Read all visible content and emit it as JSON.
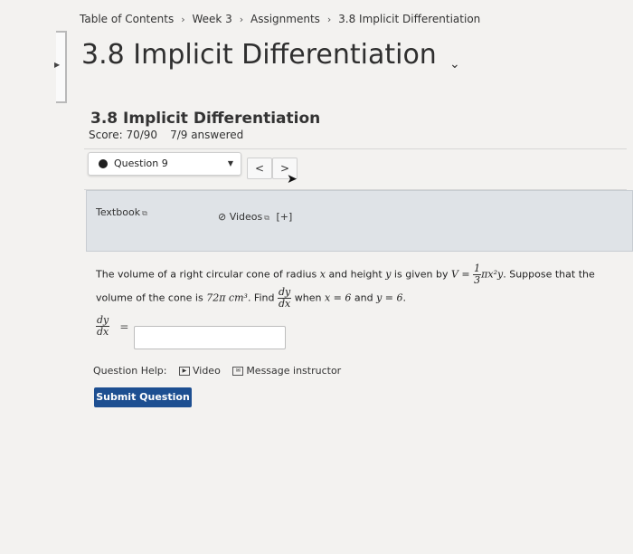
{
  "breadcrumb": {
    "items": [
      "Table of Contents",
      "Week 3",
      "Assignments",
      "3.8 Implicit Differentiation"
    ],
    "separator": "›"
  },
  "page_title": "3.8 Implicit Differentiation",
  "assignment": {
    "name": "3.8 Implicit Differentiation",
    "score": "Score: 70/90",
    "answered": "7/9 answered"
  },
  "question_nav": {
    "selected": "Question 9",
    "prev": "<",
    "next": ">"
  },
  "resources": {
    "textbook": "Textbook",
    "videos": "Videos",
    "videos_more": "[+]"
  },
  "question": {
    "line1_a": "The volume of a right circular cone of radius",
    "var_x": "x",
    "line1_b": "and height",
    "var_y": "y",
    "line1_c": "is given by",
    "V_eq": "V =",
    "frac_num": "1",
    "frac_den": "3",
    "pi_x2_y": "πx²y",
    "line1_d": ". Suppose that the",
    "line2_a": "volume of the cone is",
    "volume": "72π cm³",
    "line2_b": ". Find",
    "dy": "dy",
    "dx": "dx",
    "line2_c": "when",
    "cond_x": "x = 6",
    "and": "and",
    "cond_y": "y = 6",
    "period": "."
  },
  "answer": {
    "lhs_num": "dy",
    "lhs_den": "dx",
    "equals": "=",
    "value": ""
  },
  "help": {
    "label": "Question Help:",
    "video": "Video",
    "message": "Message instructor"
  },
  "submit_label": "Submit Question",
  "colors": {
    "submit_bg": "#1d4f91",
    "resources_bg": "#dfe3e7"
  }
}
